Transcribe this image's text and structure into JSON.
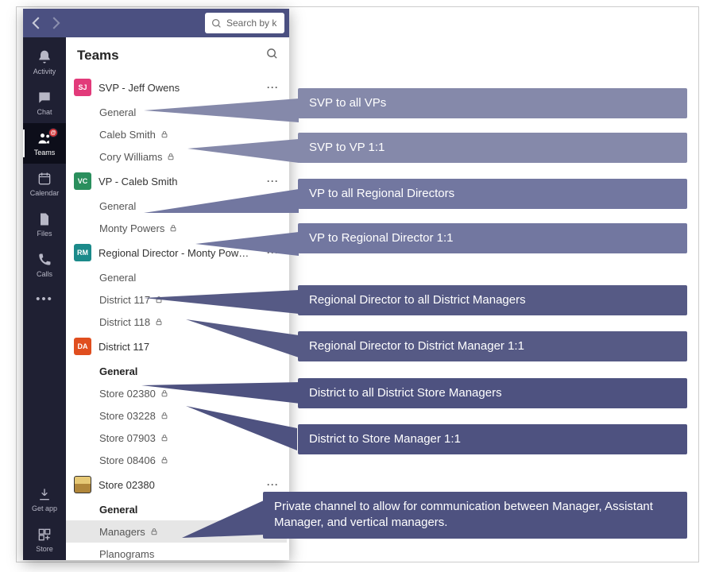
{
  "titlebar": {
    "search_placeholder": "Search by k"
  },
  "rail": {
    "items": [
      {
        "key": "activity",
        "label": "Activity"
      },
      {
        "key": "chat",
        "label": "Chat"
      },
      {
        "key": "teams",
        "label": "Teams"
      },
      {
        "key": "calendar",
        "label": "Calendar"
      },
      {
        "key": "files",
        "label": "Files"
      },
      {
        "key": "calls",
        "label": "Calls"
      }
    ],
    "bottom": [
      {
        "key": "getapp",
        "label": "Get app"
      },
      {
        "key": "store",
        "label": "Store"
      }
    ],
    "badge_text": "@"
  },
  "panel": {
    "title": "Teams"
  },
  "teams": [
    {
      "avatar_initials": "SJ",
      "avatar_color": "#e23a7a",
      "name": "SVP - Jeff Owens",
      "channels": [
        {
          "name": "General",
          "private": false
        },
        {
          "name": "Caleb Smith",
          "private": true
        },
        {
          "name": "Cory Williams",
          "private": true
        }
      ]
    },
    {
      "avatar_initials": "VC",
      "avatar_color": "#2a8f5d",
      "name": "VP - Caleb Smith",
      "channels": [
        {
          "name": "General",
          "private": false
        },
        {
          "name": "Monty Powers",
          "private": true
        }
      ]
    },
    {
      "avatar_initials": "RM",
      "avatar_color": "#1b8a8a",
      "name": "Regional Director - Monty Pow…",
      "channels": [
        {
          "name": "General",
          "private": false
        },
        {
          "name": "District 117",
          "private": true
        },
        {
          "name": "District 118",
          "private": true
        }
      ]
    },
    {
      "avatar_initials": "DA",
      "avatar_color": "#e04e1f",
      "name": "District 117",
      "channels": [
        {
          "name": "General",
          "private": false,
          "bold": true
        },
        {
          "name": "Store 02380",
          "private": true
        },
        {
          "name": "Store 03228",
          "private": true
        },
        {
          "name": "Store 07903",
          "private": true
        },
        {
          "name": "Store 08406",
          "private": true
        }
      ]
    },
    {
      "avatar_initials": "",
      "avatar_type": "store",
      "name": "Store 02380",
      "channels": [
        {
          "name": "General",
          "private": false,
          "bold": true
        },
        {
          "name": "Managers",
          "private": true,
          "selected": true
        },
        {
          "name": "Planograms",
          "private": false
        }
      ]
    }
  ],
  "callouts": [
    {
      "text": "SVP to all VPs",
      "tone": "light"
    },
    {
      "text": "SVP to VP 1:1",
      "tone": "light"
    },
    {
      "text": "VP to all Regional Directors",
      "tone": "mid"
    },
    {
      "text": "VP to Regional Director 1:1",
      "tone": "mid"
    },
    {
      "text": "Regional Director to all District Managers",
      "tone": "dark"
    },
    {
      "text": "Regional Director to District Manager 1:1",
      "tone": "dark"
    },
    {
      "text": "District to all District Store Managers",
      "tone": "darker"
    },
    {
      "text": "District to Store Manager 1:1",
      "tone": "darker"
    },
    {
      "text": "Private channel to allow for communication between Manager, Assistant Manager, and vertical managers.",
      "tone": "darker"
    }
  ]
}
